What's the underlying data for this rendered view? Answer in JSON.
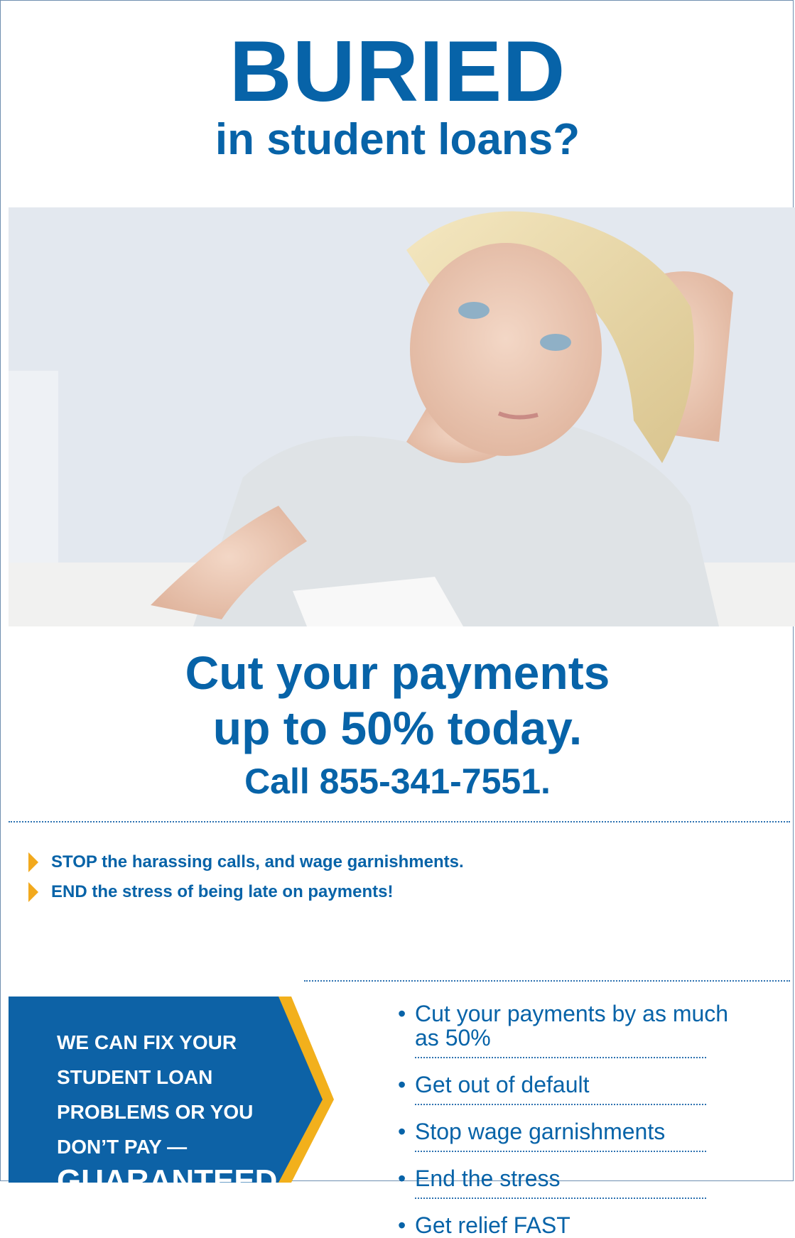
{
  "headline": {
    "big": "BURIED",
    "sub": "in student loans?"
  },
  "offer": {
    "line1": "Cut your payments",
    "line2": "up to 50% today.",
    "line3": "Call 855-341-7551."
  },
  "bullets": [
    "STOP the harassing calls, and wage garnishments.",
    "END the stress of being late on payments!"
  ],
  "guarantee": {
    "line1": "WE CAN FIX YOUR",
    "line2": "STUDENT LOAN",
    "line3": "PROBLEMS OR YOU",
    "line4": "DON’T PAY —",
    "line5": "GUARANTEED."
  },
  "benefits": [
    "Cut your payments by as much as 50%",
    "Get out of default",
    "Stop wage garnishments",
    "End the stress",
    "Get relief FAST"
  ],
  "colors": {
    "brand_blue": "#0763a8",
    "accent_gold": "#f2b01c"
  }
}
